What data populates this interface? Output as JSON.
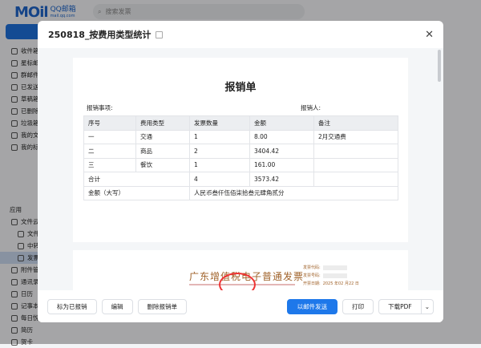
{
  "app": {
    "logo": "MOil",
    "logo_brand": "QQ邮箱",
    "logo_domain": "mail.qq.com",
    "search_placeholder": "搜索发票"
  },
  "sidebar": {
    "items": [
      {
        "label": "收件箱"
      },
      {
        "label": "星标邮件"
      },
      {
        "label": "群邮件"
      },
      {
        "label": "已发送"
      },
      {
        "label": "草稿箱"
      },
      {
        "label": "已删除"
      },
      {
        "label": "垃圾箱"
      },
      {
        "label": "我的文件夹"
      },
      {
        "label": "我的标签"
      }
    ],
    "apps_heading": "应用",
    "apps": [
      {
        "label": "文件云盘"
      },
      {
        "label": "文件"
      },
      {
        "label": "中转站"
      },
      {
        "label": "发票"
      },
      {
        "label": "附件管理"
      },
      {
        "label": "通讯录"
      },
      {
        "label": "日历"
      },
      {
        "label": "记事本"
      },
      {
        "label": "每日悦读"
      },
      {
        "label": "简历"
      },
      {
        "label": "贺卡"
      }
    ]
  },
  "modal": {
    "title": "250818_按费用类型统计",
    "report": {
      "title": "报销单",
      "matter_label": "报销事项:",
      "person_label": "报销人:",
      "headers": [
        "序号",
        "费用类型",
        "发票数量",
        "金额",
        "备注"
      ],
      "rows": [
        [
          "一",
          "交通",
          "1",
          "8.00",
          "2月交通费"
        ],
        [
          "二",
          "商品",
          "2",
          "3404.42",
          ""
        ],
        [
          "三",
          "餐饮",
          "1",
          "161.00",
          ""
        ]
      ],
      "total": {
        "label": "合计",
        "count": "4",
        "amount": "3573.42"
      },
      "capital": {
        "label": "金额（大写）",
        "value": "人民币叁仟伍佰柒拾叁元肆角贰分"
      }
    },
    "invoice": {
      "title": "广东增值税电子普通发票",
      "code_label": "发票代码:",
      "number_label": "发票号码:",
      "date_label": "开票日期:",
      "date": "2025 年02 月22 日"
    },
    "footer": {
      "mark_paid": "标为已报销",
      "edit": "编辑",
      "delete": "删除报销单",
      "send": "以邮件发送",
      "print": "打印",
      "download": "下载PDF"
    }
  }
}
